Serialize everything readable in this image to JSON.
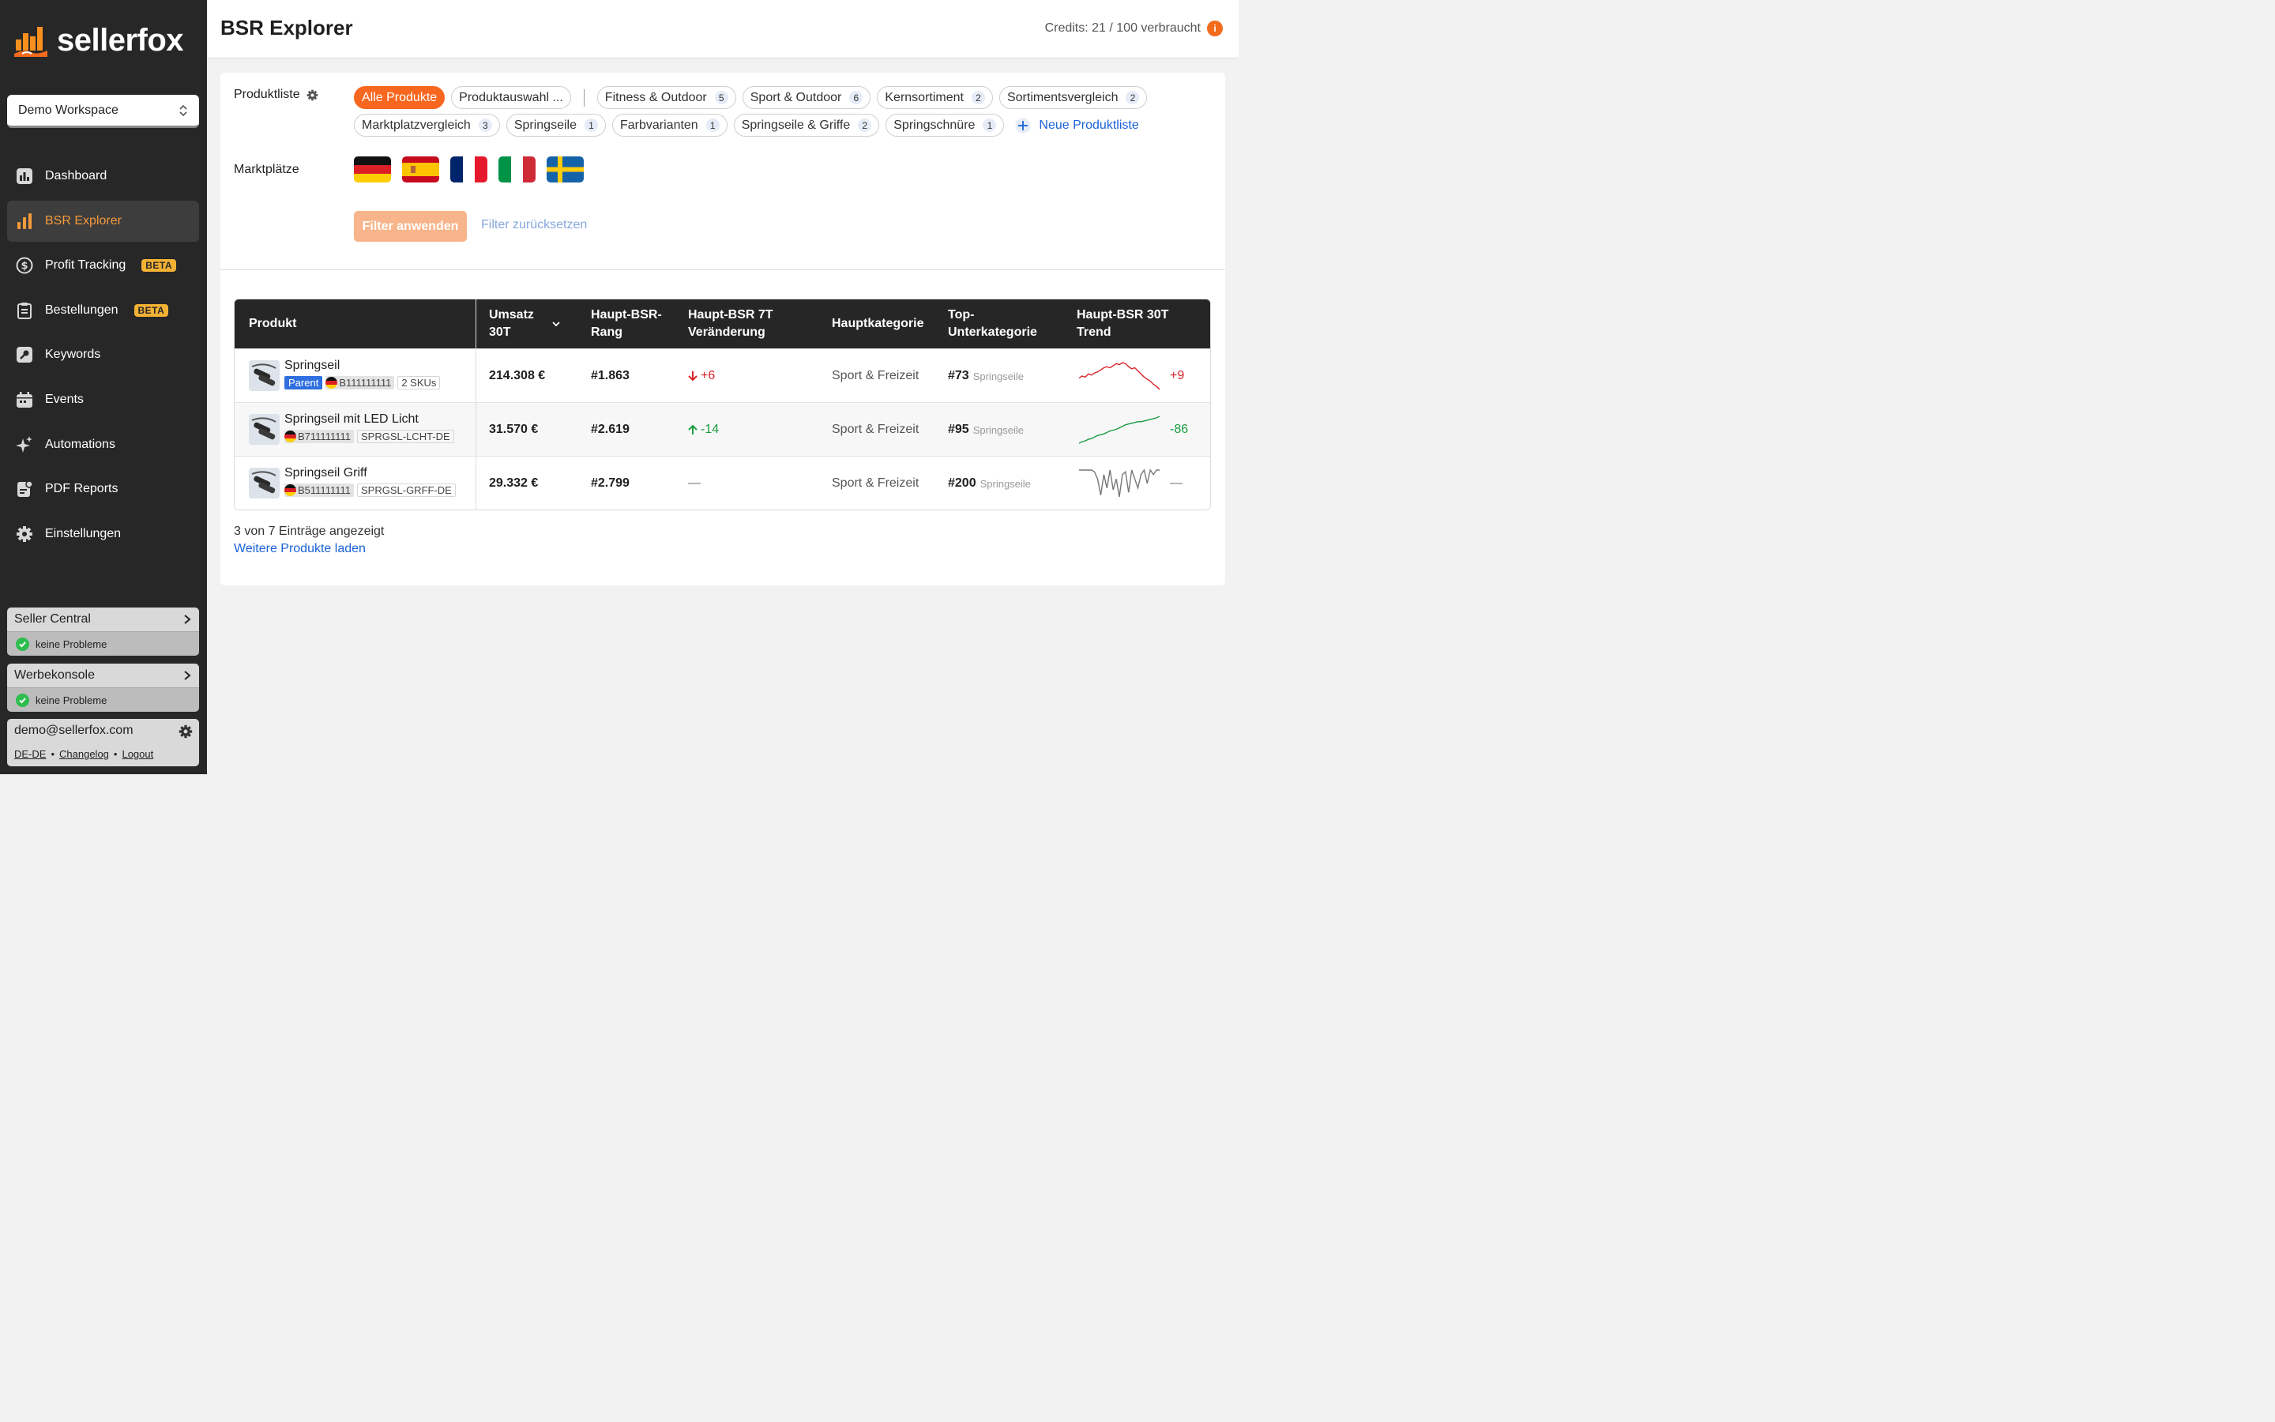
{
  "brand": {
    "name": "sellerfox",
    "accent": "#f7671f"
  },
  "workspace": {
    "label": "Demo Workspace"
  },
  "nav": [
    {
      "label": "Dashboard",
      "icon": "dashboard-icon",
      "badge": ""
    },
    {
      "label": "BSR Explorer",
      "icon": "bar-chart-icon",
      "badge": "",
      "active": true
    },
    {
      "label": "Profit Tracking",
      "icon": "dollar-icon",
      "badge": "BETA"
    },
    {
      "label": "Bestellungen",
      "icon": "clipboard-icon",
      "badge": "BETA"
    },
    {
      "label": "Keywords",
      "icon": "key-icon",
      "badge": ""
    },
    {
      "label": "Events",
      "icon": "calendar-icon",
      "badge": ""
    },
    {
      "label": "Automations",
      "icon": "sparkle-icon",
      "badge": ""
    },
    {
      "label": "PDF Reports",
      "icon": "report-icon",
      "badge": ""
    },
    {
      "label": "Einstellungen",
      "icon": "gear-icon",
      "badge": ""
    }
  ],
  "status": [
    {
      "title": "Seller Central",
      "state": "keine Probleme"
    },
    {
      "title": "Werbekonsole",
      "state": "keine Probleme"
    }
  ],
  "user": {
    "email": "demo@sellerfox.com",
    "links": [
      "DE-DE",
      "Changelog",
      "Logout"
    ],
    "sep": "•"
  },
  "header": {
    "title": "BSR Explorer",
    "credits": "Credits: 21 / 100 verbraucht",
    "info": "i"
  },
  "filters": {
    "product_list_label": "Produktliste",
    "marketplaces_label": "Marktplätze",
    "chips_primary": [
      {
        "label": "Alle Produkte",
        "active": true
      },
      {
        "label": "Produktauswahl ..."
      }
    ],
    "chips": [
      {
        "label": "Fitness & Outdoor",
        "count": "5"
      },
      {
        "label": "Sport & Outdoor",
        "count": "6"
      },
      {
        "label": "Kernsortiment",
        "count": "2"
      },
      {
        "label": "Sortimentsvergleich",
        "count": "2"
      },
      {
        "label": "Marktplatzvergleich",
        "count": "3"
      },
      {
        "label": "Springseile",
        "count": "1"
      },
      {
        "label": "Farbvarianten",
        "count": "1"
      },
      {
        "label": "Springseile & Griffe",
        "count": "2"
      },
      {
        "label": "Springschnüre",
        "count": "1"
      }
    ],
    "new_list": "Neue Produktliste",
    "marketplaces": [
      "DE",
      "ES",
      "FR",
      "IT",
      "SE"
    ],
    "apply": "Filter anwenden",
    "reset": "Filter zurücksetzen"
  },
  "table": {
    "headers": {
      "product": "Produkt",
      "revenue_1": "Umsatz",
      "revenue_2": "30T",
      "rank_1": "Haupt-BSR-",
      "rank_2": "Rang",
      "change_1": "Haupt-BSR 7T",
      "change_2": "Veränderung",
      "category": "Hauptkategorie",
      "subcat_1": "Top-",
      "subcat_2": "Unterkategorie",
      "trend_1": "Haupt-BSR 30T",
      "trend_2": "Trend"
    },
    "rows": [
      {
        "name": "Springseil",
        "parent": "Parent",
        "asin": "B111111111",
        "sku": "2 SKUs",
        "revenue": "214.308 €",
        "rank": "#1.863",
        "change": "+6",
        "change_dir": "down",
        "category": "Sport & Freizeit",
        "sub_rank": "#73",
        "sub_name": "Springseile",
        "trend_value": "+9",
        "trend_color": "#d8232a",
        "trend": [
          36,
          38,
          37,
          40,
          39,
          41,
          42,
          44,
          46,
          47,
          46,
          48,
          50,
          49,
          51,
          50,
          47,
          45,
          46,
          43,
          40,
          37,
          35,
          33,
          30,
          28,
          25
        ]
      },
      {
        "name": "Springseil mit LED Licht",
        "parent": "",
        "asin": "B711111111",
        "sku": "SPRGSL-LCHT-DE",
        "revenue": "31.570 €",
        "rank": "#2.619",
        "change": "-14",
        "change_dir": "up",
        "category": "Sport & Freizeit",
        "sub_rank": "#95",
        "sub_name": "Springseile",
        "trend_value": "-86",
        "trend_color": "#1a9e3f",
        "trend": [
          20,
          22,
          23,
          25,
          26,
          28,
          30,
          31,
          32,
          34,
          36,
          37,
          38,
          40,
          42,
          44,
          45,
          46,
          47,
          48,
          48,
          49,
          50,
          51,
          52,
          53,
          55
        ]
      },
      {
        "name": "Springseil Griff",
        "parent": "",
        "asin": "B511111111",
        "sku": "SPRGSL-GRFF-DE",
        "revenue": "29.332 €",
        "rank": "#2.799",
        "change": "—",
        "change_dir": "none",
        "category": "Sport & Freizeit",
        "sub_rank": "#200",
        "sub_name": "Springseile",
        "trend_value": "—",
        "trend_color": "#777",
        "trend": [
          50,
          50,
          50,
          50,
          50,
          48,
          40,
          22,
          45,
          30,
          50,
          28,
          40,
          20,
          45,
          48,
          25,
          50,
          40,
          30,
          45,
          50,
          35,
          50,
          45,
          50,
          50
        ]
      }
    ]
  },
  "footer": {
    "count": "3 von 7 Einträge angezeigt",
    "more": "Weitere Produkte laden"
  }
}
